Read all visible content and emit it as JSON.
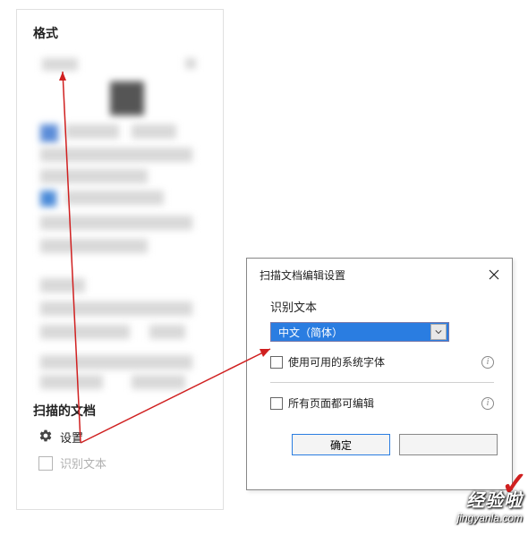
{
  "left_panel": {
    "title": "格式",
    "scanned_title": "扫描的文档",
    "settings_label": "设置",
    "ocr_label": "识别文本"
  },
  "dialog": {
    "title": "扫描文档编辑设置",
    "body_label": "识别文本",
    "dropdown_value": "中文（简体）",
    "system_font_label": "使用可用的系统字体",
    "all_pages_label": "所有页面都可编辑",
    "ok_label": "确定",
    "cancel_label": ""
  },
  "watermark": {
    "brand": "经验啦",
    "url": "jingyanla.com"
  }
}
